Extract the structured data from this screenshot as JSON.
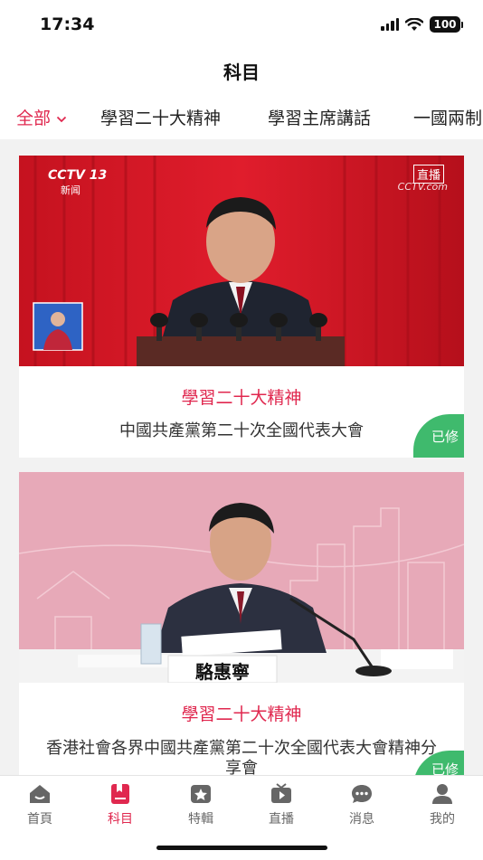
{
  "status_bar": {
    "time": "17:34",
    "battery": "100"
  },
  "header": {
    "title": "科目"
  },
  "tabs": [
    {
      "label": "全部",
      "active": true
    },
    {
      "label": "學習二十大精神",
      "active": false
    },
    {
      "label": "學習主席講話",
      "active": false
    },
    {
      "label": "一國兩制",
      "active": false
    }
  ],
  "cards": [
    {
      "category": "學習二十大精神",
      "title": "中國共產黨第二十次全國代表大會",
      "badge": "已修",
      "image": {
        "logo": "CCTV 13",
        "logo_sub": "新闻",
        "live": "直播",
        "watermark": "CCTV.com"
      }
    },
    {
      "category": "學習二十大精神",
      "title": "香港社會各界中國共產黨第二十次全國代表大會精神分享會",
      "badge": "已修",
      "image": {
        "nameplate": "駱惠寧"
      }
    }
  ],
  "bottom_nav": [
    {
      "label": "首頁",
      "icon": "home-icon",
      "active": false
    },
    {
      "label": "科目",
      "icon": "bookmark-book-icon",
      "active": true
    },
    {
      "label": "特輯",
      "icon": "star-folder-icon",
      "active": false
    },
    {
      "label": "直播",
      "icon": "live-tv-icon",
      "active": false
    },
    {
      "label": "消息",
      "icon": "chat-bubble-icon",
      "active": false
    },
    {
      "label": "我的",
      "icon": "person-icon",
      "active": false
    }
  ],
  "colors": {
    "accent": "#e0284f",
    "badge": "#3fba6d",
    "background": "#f2f2f2"
  }
}
